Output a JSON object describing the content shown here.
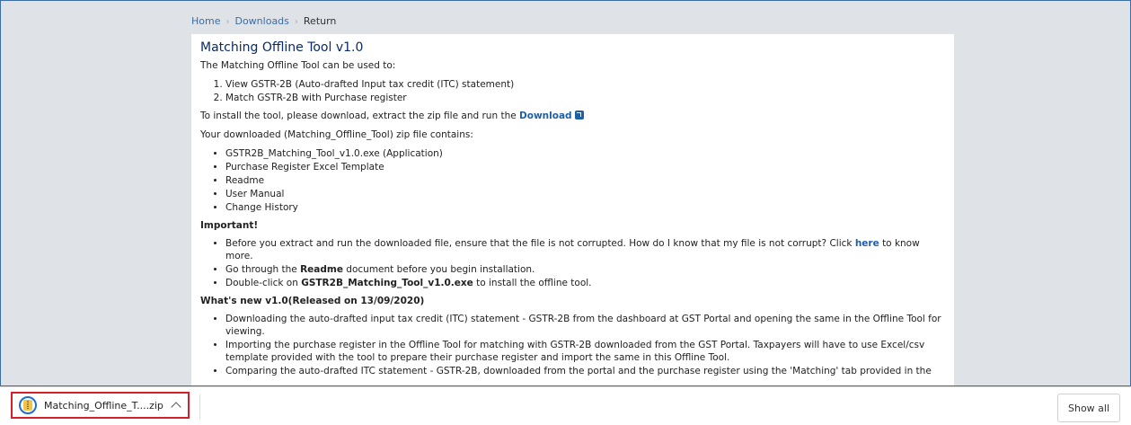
{
  "breadcrumb": {
    "home": "Home",
    "downloads": "Downloads",
    "current": "Return"
  },
  "content": {
    "title": "Matching Offline Tool v1.0",
    "intro": "The Matching Offline Tool can be used to:",
    "uses": [
      "View GSTR-2B (Auto-drafted Input tax credit (ITC) statement)",
      "Match GSTR-2B with Purchase register"
    ],
    "install_text": "To install the tool, please download, extract the zip file and run the",
    "download_link": "Download",
    "contains_text": "Your downloaded (Matching_Offline_Tool) zip file contains:",
    "contents": [
      "GSTR2B_Matching_Tool_v1.0.exe (Application)",
      "Purchase Register Excel Template",
      "Readme",
      "User Manual",
      "Change History"
    ],
    "important_heading": "Important!",
    "important": {
      "item1_text": "Before you extract and run the downloaded file, ensure that the file is not corrupted. How do I know that my file is not corrupt? Click",
      "item1_link": "here",
      "item1_after": "to know more.",
      "item2_pre": "Go through the",
      "item2_bold": "Readme",
      "item2_post": "document before you begin installation.",
      "item3_pre": "Double-click on",
      "item3_bold": "GSTR2B_Matching_Tool_v1.0.exe",
      "item3_post": "to install the offline tool."
    },
    "whats_new_heading": "What's new v1.0(Released on 13/09/2020)",
    "whats_new": [
      "Downloading the auto-drafted input tax credit (ITC) statement - GSTR-2B from the dashboard at GST Portal and opening the same in the Offline Tool for viewing.",
      "Importing the purchase register in the Offline Tool for matching with GSTR-2B downloaded from the GST Portal. Taxpayers will have to use Excel/csv template provided with the tool to prepare their purchase register and import the same in this Offline Tool.",
      "Comparing the auto-drafted ITC statement - GSTR-2B, downloaded from the portal and the purchase register using the 'Matching' tab provided in the"
    ]
  },
  "download_bar": {
    "file_name": "Matching_Offline_T....zip",
    "show_all": "Show all",
    "highlight_color": "#d3202b"
  }
}
